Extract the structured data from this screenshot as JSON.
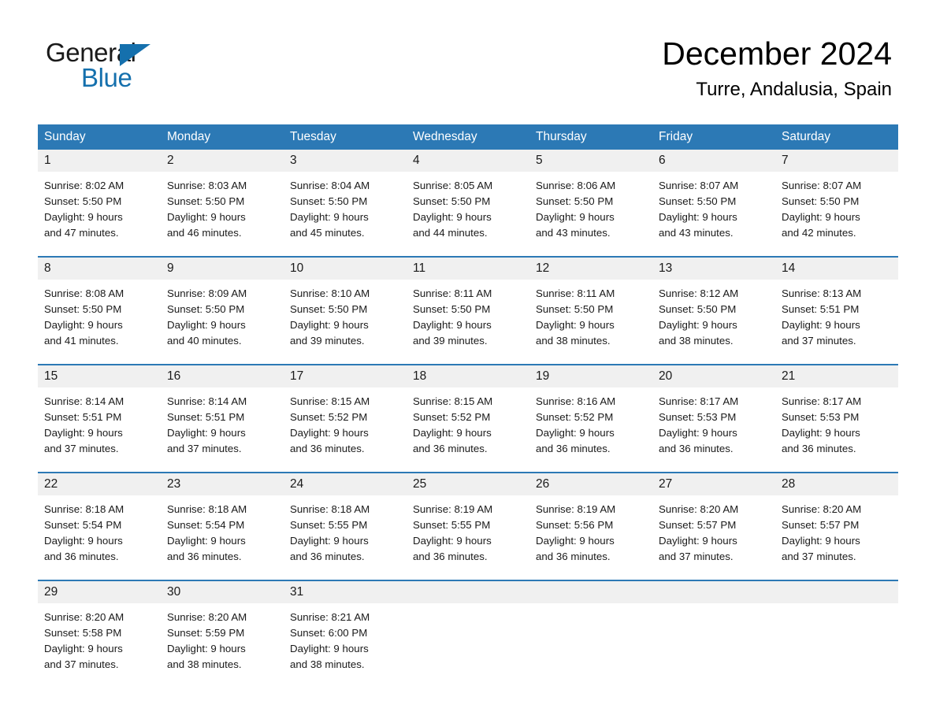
{
  "brand": {
    "name_part1": "General",
    "name_part2": "Blue",
    "triangle_color": "#1570ad",
    "accent_color": "#2c79b5"
  },
  "header": {
    "month_title": "December 2024",
    "location": "Turre, Andalusia, Spain"
  },
  "calendar": {
    "weekdays": [
      "Sunday",
      "Monday",
      "Tuesday",
      "Wednesday",
      "Thursday",
      "Friday",
      "Saturday"
    ],
    "weeks": [
      {
        "days": [
          {
            "num": "1",
            "sunrise": "Sunrise: 8:02 AM",
            "sunset": "Sunset: 5:50 PM",
            "daylight_1": "Daylight: 9 hours",
            "daylight_2": "and 47 minutes."
          },
          {
            "num": "2",
            "sunrise": "Sunrise: 8:03 AM",
            "sunset": "Sunset: 5:50 PM",
            "daylight_1": "Daylight: 9 hours",
            "daylight_2": "and 46 minutes."
          },
          {
            "num": "3",
            "sunrise": "Sunrise: 8:04 AM",
            "sunset": "Sunset: 5:50 PM",
            "daylight_1": "Daylight: 9 hours",
            "daylight_2": "and 45 minutes."
          },
          {
            "num": "4",
            "sunrise": "Sunrise: 8:05 AM",
            "sunset": "Sunset: 5:50 PM",
            "daylight_1": "Daylight: 9 hours",
            "daylight_2": "and 44 minutes."
          },
          {
            "num": "5",
            "sunrise": "Sunrise: 8:06 AM",
            "sunset": "Sunset: 5:50 PM",
            "daylight_1": "Daylight: 9 hours",
            "daylight_2": "and 43 minutes."
          },
          {
            "num": "6",
            "sunrise": "Sunrise: 8:07 AM",
            "sunset": "Sunset: 5:50 PM",
            "daylight_1": "Daylight: 9 hours",
            "daylight_2": "and 43 minutes."
          },
          {
            "num": "7",
            "sunrise": "Sunrise: 8:07 AM",
            "sunset": "Sunset: 5:50 PM",
            "daylight_1": "Daylight: 9 hours",
            "daylight_2": "and 42 minutes."
          }
        ]
      },
      {
        "days": [
          {
            "num": "8",
            "sunrise": "Sunrise: 8:08 AM",
            "sunset": "Sunset: 5:50 PM",
            "daylight_1": "Daylight: 9 hours",
            "daylight_2": "and 41 minutes."
          },
          {
            "num": "9",
            "sunrise": "Sunrise: 8:09 AM",
            "sunset": "Sunset: 5:50 PM",
            "daylight_1": "Daylight: 9 hours",
            "daylight_2": "and 40 minutes."
          },
          {
            "num": "10",
            "sunrise": "Sunrise: 8:10 AM",
            "sunset": "Sunset: 5:50 PM",
            "daylight_1": "Daylight: 9 hours",
            "daylight_2": "and 39 minutes."
          },
          {
            "num": "11",
            "sunrise": "Sunrise: 8:11 AM",
            "sunset": "Sunset: 5:50 PM",
            "daylight_1": "Daylight: 9 hours",
            "daylight_2": "and 39 minutes."
          },
          {
            "num": "12",
            "sunrise": "Sunrise: 8:11 AM",
            "sunset": "Sunset: 5:50 PM",
            "daylight_1": "Daylight: 9 hours",
            "daylight_2": "and 38 minutes."
          },
          {
            "num": "13",
            "sunrise": "Sunrise: 8:12 AM",
            "sunset": "Sunset: 5:50 PM",
            "daylight_1": "Daylight: 9 hours",
            "daylight_2": "and 38 minutes."
          },
          {
            "num": "14",
            "sunrise": "Sunrise: 8:13 AM",
            "sunset": "Sunset: 5:51 PM",
            "daylight_1": "Daylight: 9 hours",
            "daylight_2": "and 37 minutes."
          }
        ]
      },
      {
        "days": [
          {
            "num": "15",
            "sunrise": "Sunrise: 8:14 AM",
            "sunset": "Sunset: 5:51 PM",
            "daylight_1": "Daylight: 9 hours",
            "daylight_2": "and 37 minutes."
          },
          {
            "num": "16",
            "sunrise": "Sunrise: 8:14 AM",
            "sunset": "Sunset: 5:51 PM",
            "daylight_1": "Daylight: 9 hours",
            "daylight_2": "and 37 minutes."
          },
          {
            "num": "17",
            "sunrise": "Sunrise: 8:15 AM",
            "sunset": "Sunset: 5:52 PM",
            "daylight_1": "Daylight: 9 hours",
            "daylight_2": "and 36 minutes."
          },
          {
            "num": "18",
            "sunrise": "Sunrise: 8:15 AM",
            "sunset": "Sunset: 5:52 PM",
            "daylight_1": "Daylight: 9 hours",
            "daylight_2": "and 36 minutes."
          },
          {
            "num": "19",
            "sunrise": "Sunrise: 8:16 AM",
            "sunset": "Sunset: 5:52 PM",
            "daylight_1": "Daylight: 9 hours",
            "daylight_2": "and 36 minutes."
          },
          {
            "num": "20",
            "sunrise": "Sunrise: 8:17 AM",
            "sunset": "Sunset: 5:53 PM",
            "daylight_1": "Daylight: 9 hours",
            "daylight_2": "and 36 minutes."
          },
          {
            "num": "21",
            "sunrise": "Sunrise: 8:17 AM",
            "sunset": "Sunset: 5:53 PM",
            "daylight_1": "Daylight: 9 hours",
            "daylight_2": "and 36 minutes."
          }
        ]
      },
      {
        "days": [
          {
            "num": "22",
            "sunrise": "Sunrise: 8:18 AM",
            "sunset": "Sunset: 5:54 PM",
            "daylight_1": "Daylight: 9 hours",
            "daylight_2": "and 36 minutes."
          },
          {
            "num": "23",
            "sunrise": "Sunrise: 8:18 AM",
            "sunset": "Sunset: 5:54 PM",
            "daylight_1": "Daylight: 9 hours",
            "daylight_2": "and 36 minutes."
          },
          {
            "num": "24",
            "sunrise": "Sunrise: 8:18 AM",
            "sunset": "Sunset: 5:55 PM",
            "daylight_1": "Daylight: 9 hours",
            "daylight_2": "and 36 minutes."
          },
          {
            "num": "25",
            "sunrise": "Sunrise: 8:19 AM",
            "sunset": "Sunset: 5:55 PM",
            "daylight_1": "Daylight: 9 hours",
            "daylight_2": "and 36 minutes."
          },
          {
            "num": "26",
            "sunrise": "Sunrise: 8:19 AM",
            "sunset": "Sunset: 5:56 PM",
            "daylight_1": "Daylight: 9 hours",
            "daylight_2": "and 36 minutes."
          },
          {
            "num": "27",
            "sunrise": "Sunrise: 8:20 AM",
            "sunset": "Sunset: 5:57 PM",
            "daylight_1": "Daylight: 9 hours",
            "daylight_2": "and 37 minutes."
          },
          {
            "num": "28",
            "sunrise": "Sunrise: 8:20 AM",
            "sunset": "Sunset: 5:57 PM",
            "daylight_1": "Daylight: 9 hours",
            "daylight_2": "and 37 minutes."
          }
        ]
      },
      {
        "days": [
          {
            "num": "29",
            "sunrise": "Sunrise: 8:20 AM",
            "sunset": "Sunset: 5:58 PM",
            "daylight_1": "Daylight: 9 hours",
            "daylight_2": "and 37 minutes."
          },
          {
            "num": "30",
            "sunrise": "Sunrise: 8:20 AM",
            "sunset": "Sunset: 5:59 PM",
            "daylight_1": "Daylight: 9 hours",
            "daylight_2": "and 38 minutes."
          },
          {
            "num": "31",
            "sunrise": "Sunrise: 8:21 AM",
            "sunset": "Sunset: 6:00 PM",
            "daylight_1": "Daylight: 9 hours",
            "daylight_2": "and 38 minutes."
          },
          {
            "num": "",
            "sunrise": "",
            "sunset": "",
            "daylight_1": "",
            "daylight_2": ""
          },
          {
            "num": "",
            "sunrise": "",
            "sunset": "",
            "daylight_1": "",
            "daylight_2": ""
          },
          {
            "num": "",
            "sunrise": "",
            "sunset": "",
            "daylight_1": "",
            "daylight_2": ""
          },
          {
            "num": "",
            "sunrise": "",
            "sunset": "",
            "daylight_1": "",
            "daylight_2": ""
          }
        ]
      }
    ]
  }
}
